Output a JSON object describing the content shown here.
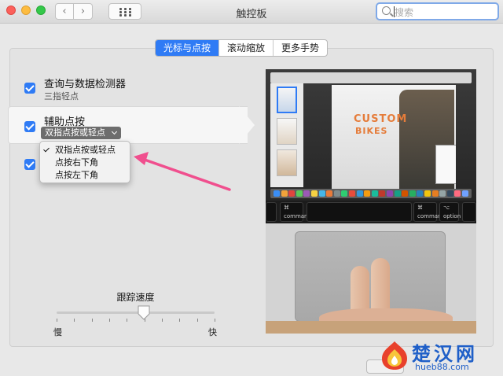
{
  "window": {
    "title": "触控板"
  },
  "toolbar": {
    "back_glyph": "‹",
    "forward_glyph": "›"
  },
  "search": {
    "placeholder": "搜索"
  },
  "tabs": [
    {
      "label": "光标与点按",
      "active": true
    },
    {
      "label": "滚动缩放",
      "active": false
    },
    {
      "label": "更多手势",
      "active": false
    }
  ],
  "options": {
    "lookup": {
      "title": "查询与数据检测器",
      "subtitle": "三指轻点",
      "checked": true
    },
    "secondary_click": {
      "title": "辅助点按",
      "checked": true,
      "selected": "双指点按或轻点"
    },
    "third": {
      "checked": true
    }
  },
  "dropdown_menu": {
    "items": [
      {
        "label": "双指点按或轻点",
        "checked": true
      },
      {
        "label": "点按右下角",
        "checked": false
      },
      {
        "label": "点按左下角",
        "checked": false
      }
    ]
  },
  "tracking_speed": {
    "label": "跟踪速度",
    "min_label": "慢",
    "max_label": "快",
    "value_fraction": 0.55,
    "tick_count": 10
  },
  "preview": {
    "headline_1": "CUSTOM",
    "headline_2": "BIKES",
    "touchbar_left_symbol": "⌘",
    "touchbar_left_label": "command",
    "touchbar_right_symbol": "⌘",
    "touchbar_right_label": "command",
    "touchbar_opt_symbol": "⌥",
    "touchbar_opt_label": "option",
    "touchbar_esc_label": "option"
  },
  "watermark": {
    "name": "楚汉网",
    "url": "hueb88.com"
  },
  "colors": {
    "accent": "#2f7bf5",
    "arrow": "#f04f8e"
  }
}
